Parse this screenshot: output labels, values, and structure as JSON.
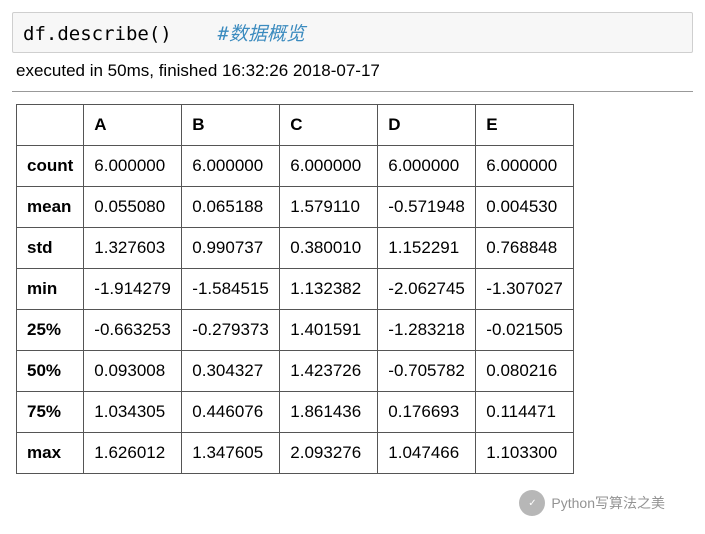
{
  "code": {
    "call": "df.describe()",
    "comment": "#数据概览"
  },
  "exec_info": "executed in 50ms, finished 16:32:26 2018-07-17",
  "table": {
    "columns": [
      "A",
      "B",
      "C",
      "D",
      "E"
    ],
    "index": [
      "count",
      "mean",
      "std",
      "min",
      "25%",
      "50%",
      "75%",
      "max"
    ],
    "rows": [
      [
        "6.000000",
        "6.000000",
        "6.000000",
        "6.000000",
        "6.000000"
      ],
      [
        "0.055080",
        "0.065188",
        "1.579110",
        "-0.571948",
        "0.004530"
      ],
      [
        "1.327603",
        "0.990737",
        "0.380010",
        "1.152291",
        "0.768848"
      ],
      [
        "-1.914279",
        "-1.584515",
        "1.132382",
        "-2.062745",
        "-1.307027"
      ],
      [
        "-0.663253",
        "-0.279373",
        "1.401591",
        "-1.283218",
        "-0.021505"
      ],
      [
        "0.093008",
        "0.304327",
        "1.423726",
        "-0.705782",
        "0.080216"
      ],
      [
        "1.034305",
        "0.446076",
        "1.861436",
        "0.176693",
        "0.114471"
      ],
      [
        "1.626012",
        "1.347605",
        "2.093276",
        "1.047466",
        "1.103300"
      ]
    ]
  },
  "watermark": {
    "text": "Python写算法之美"
  }
}
